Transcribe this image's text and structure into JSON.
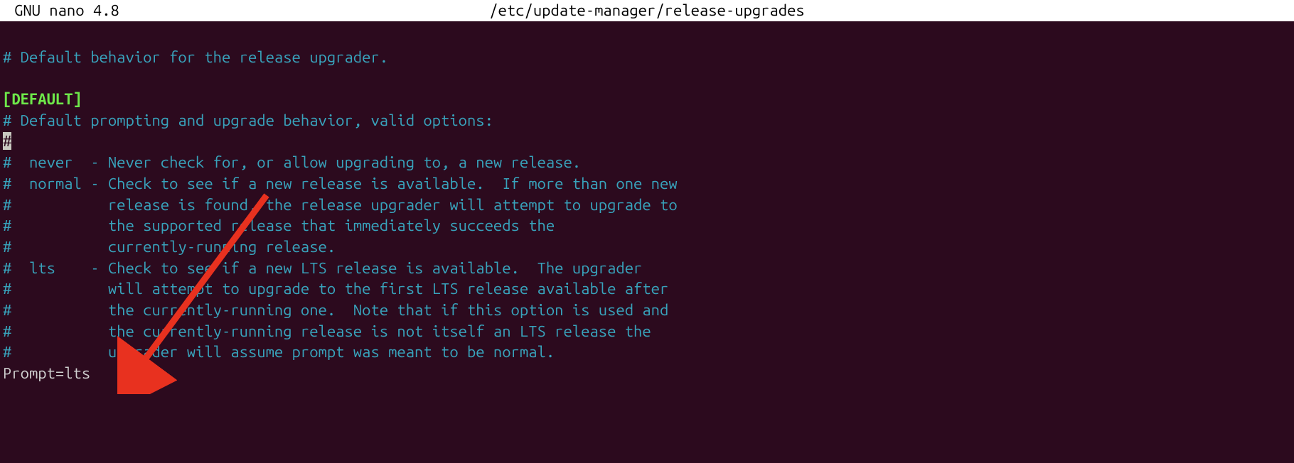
{
  "titlebar": {
    "app": "GNU nano 4.8",
    "file": "/etc/update-manager/release-upgrades"
  },
  "lines": {
    "l0": "# Default behavior for the release upgrader.",
    "l1": "",
    "l2": "[DEFAULT]",
    "l3": "# Default prompting and upgrade behavior, valid options:",
    "l4_cursor": "#",
    "l5": "#  never  - Never check for, or allow upgrading to, a new release.",
    "l6": "#  normal - Check to see if a new release is available.  If more than one new",
    "l7": "#           release is found, the release upgrader will attempt to upgrade to",
    "l8": "#           the supported release that immediately succeeds the",
    "l9": "#           currently-running release.",
    "l10": "#  lts    - Check to see if a new LTS release is available.  The upgrader",
    "l11": "#           will attempt to upgrade to the first LTS release available after",
    "l12": "#           the currently-running one.  Note that if this option is used and",
    "l13": "#           the currently-running release is not itself an LTS release the",
    "l14": "#           upgrader will assume prompt was meant to be normal.",
    "l15": "Prompt=lts"
  }
}
